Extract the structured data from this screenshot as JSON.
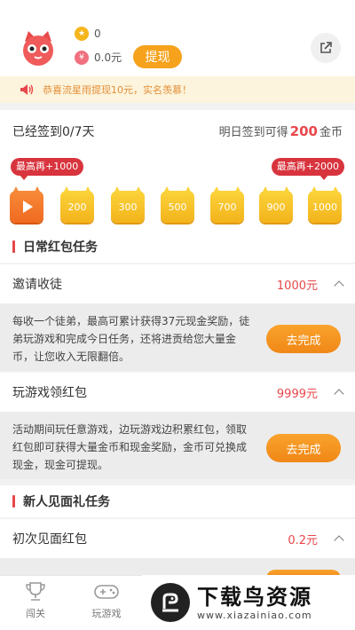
{
  "header": {
    "coins": "0",
    "cash": "0.0元",
    "withdraw_label": "提现",
    "coin_icon_glyph": "★",
    "cash_icon_glyph": "¥"
  },
  "notice": {
    "text": "恭喜流星雨提现10元，实名羡慕！"
  },
  "checkin": {
    "status": "已经签到0/7天",
    "tomorrow_prefix": "明日签到可得",
    "tomorrow_amount": "200",
    "tomorrow_suffix": "金币",
    "bonus_left": "最高再+1000",
    "bonus_right": "最高再+2000",
    "days": [
      "",
      "200",
      "300",
      "500",
      "700",
      "900",
      "1000"
    ]
  },
  "daily_section": {
    "title": "日常红包任务"
  },
  "tasks": [
    {
      "name": "邀请收徒",
      "reward": "1000元",
      "desc": "每收一个徒弟，最高可累计获得37元现金奖励，徒弟玩游戏和完成今日任务，还将进贡给您大量金币，让您收入无限翻倍。",
      "button": "去完成"
    },
    {
      "name": "玩游戏领红包",
      "reward": "9999元",
      "desc": "活动期间玩任意游戏，边玩游戏边积累红包，领取红包即可获得大量金币和现金奖励，金币可兑换成现金，现金可提现。",
      "button": "去完成"
    }
  ],
  "newbie_section": {
    "title": "新人见面礼任务"
  },
  "newbie_task": {
    "name": "初次见面红包",
    "reward": "0.2元"
  },
  "tabbar": {
    "tab1": "闯关",
    "tab2": "玩游戏"
  },
  "watermark": {
    "title": "下载鸟资源",
    "url": "www.xiazainiao.com"
  },
  "colors": {
    "accent": "#e8474b",
    "button": "#f6a21c",
    "notice_bg": "#fcf4dc"
  }
}
